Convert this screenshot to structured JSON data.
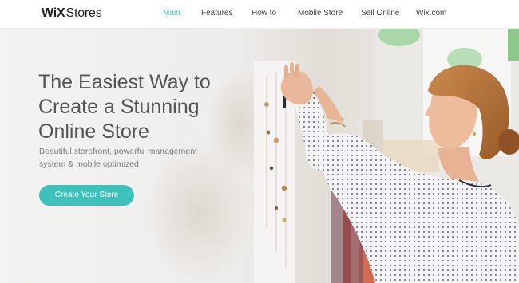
{
  "header": {
    "logo": {
      "wix": "WiX",
      "stores": "Stores"
    },
    "nav": [
      {
        "label": "Main",
        "active": true
      },
      {
        "label": "Features",
        "active": false
      },
      {
        "label": "How to",
        "active": false
      },
      {
        "label": "Mobile Store",
        "active": false
      },
      {
        "label": "Sell Online",
        "active": false
      },
      {
        "label": "Wix.com",
        "active": false
      }
    ]
  },
  "hero": {
    "title_lines": [
      "The Easiest Way to",
      "Create a Stunning",
      "Online Store"
    ],
    "subtitle_lines": [
      "Beautiful storefront, powerful management",
      "system & mobile optimized"
    ],
    "cta_label": "Create Your Store"
  },
  "colors": {
    "accent": "#3fc1bb",
    "nav_active": "#3bbfb8",
    "title_text": "#555555"
  },
  "icons": {
    "hero_image": "woman-pinning-jewelry-photo"
  }
}
